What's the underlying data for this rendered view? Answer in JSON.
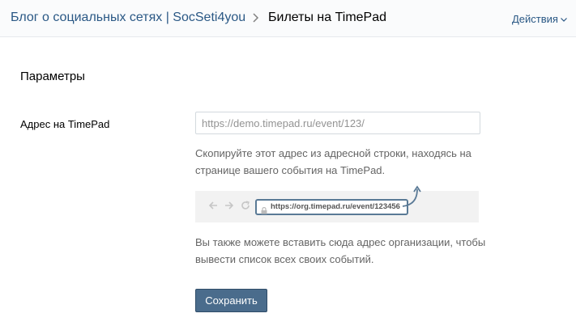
{
  "header": {
    "breadcrumb_parent": "Блог о социальных сетях | SocSeti4you",
    "breadcrumb_current": "Билеты на TimePad",
    "actions_label": "Действия"
  },
  "form": {
    "section_title": "Параметры",
    "field_label": "Адрес на TimePad",
    "url_placeholder": "https://demo.timepad.ru/event/123/",
    "hint_copy": "Скопируйте этот адрес из адресной строки, находясь на странице вашего события на TimePad.",
    "demo_url": "https://org.timepad.ru/event/123456",
    "hint_org": "Вы также можете вставить сюда адрес организации, чтобы вывести список всех своих событий.",
    "save_label": "Сохранить"
  },
  "colors": {
    "link": "#2a5885",
    "button_bg": "#4a6c8c",
    "header_bg": "#fafbfc"
  },
  "icons": {
    "breadcrumb_separator": "chevron-right-icon",
    "actions_dropdown": "chevron-down-icon",
    "demo_back": "arrow-left-icon",
    "demo_forward": "arrow-right-icon",
    "demo_reload": "reload-icon",
    "demo_lock": "lock-icon",
    "demo_pointer": "curved-arrow-icon"
  }
}
